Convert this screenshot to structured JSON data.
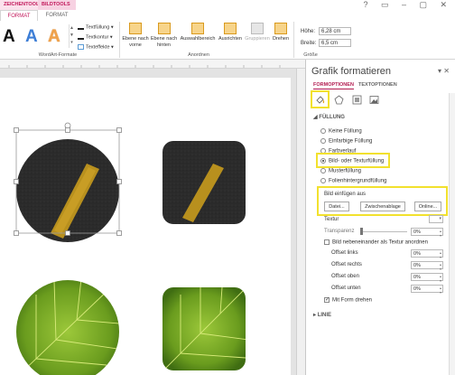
{
  "ribbon": {
    "context_tabs": [
      "ZEICHENTOOLS",
      "BILDTOOLS"
    ],
    "tabs": [
      "FORMAT",
      "FORMAT"
    ],
    "window_controls": "? ▭ – ▢ ✕",
    "wordart_letters": [
      "A",
      "A",
      "A"
    ],
    "fill_commands": [
      "Textfüllung",
      "Textkontur",
      "Texteffekte"
    ],
    "buttons": [
      "Ebene nach vorne",
      "Ebene nach hinten",
      "Auswahlbereich",
      "Ausrichten",
      "Gruppieren",
      "Drehen"
    ],
    "size": {
      "height_label": "Höhe:",
      "height_value": "6,28 cm",
      "width_label": "Breite:",
      "width_value": "6,5 cm"
    },
    "groups": [
      "WordArt-Formate",
      "Anordnen",
      "Größe"
    ]
  },
  "pane": {
    "title": "Grafik formatieren",
    "tabs": [
      "FORMOPTIONEN",
      "TEXTOPTIONEN"
    ],
    "section_fill": "FÜLLUNG",
    "fill_options": [
      "Keine Füllung",
      "Einfarbige Füllung",
      "Farbverlauf",
      "Bild- oder Texturfüllung",
      "Musterfüllung",
      "Folienhintergrundfüllung"
    ],
    "selected_fill": 3,
    "insert_from_label": "Bild einfügen aus",
    "insert_buttons": [
      "Datei...",
      "Zwischenablage",
      "Online..."
    ],
    "texture_label": "Textur",
    "transparency_label": "Transparenz",
    "transparency_value": "0%",
    "tile_label": "Bild nebeneinander als Textur anordnen",
    "offsets": [
      {
        "label": "Offset links",
        "value": "0%"
      },
      {
        "label": "Offset rechts",
        "value": "0%"
      },
      {
        "label": "Offset oben",
        "value": "0%"
      },
      {
        "label": "Offset unten",
        "value": "0%"
      }
    ],
    "rotate_label": "Mit Form drehen",
    "section_line": "LINIE"
  }
}
